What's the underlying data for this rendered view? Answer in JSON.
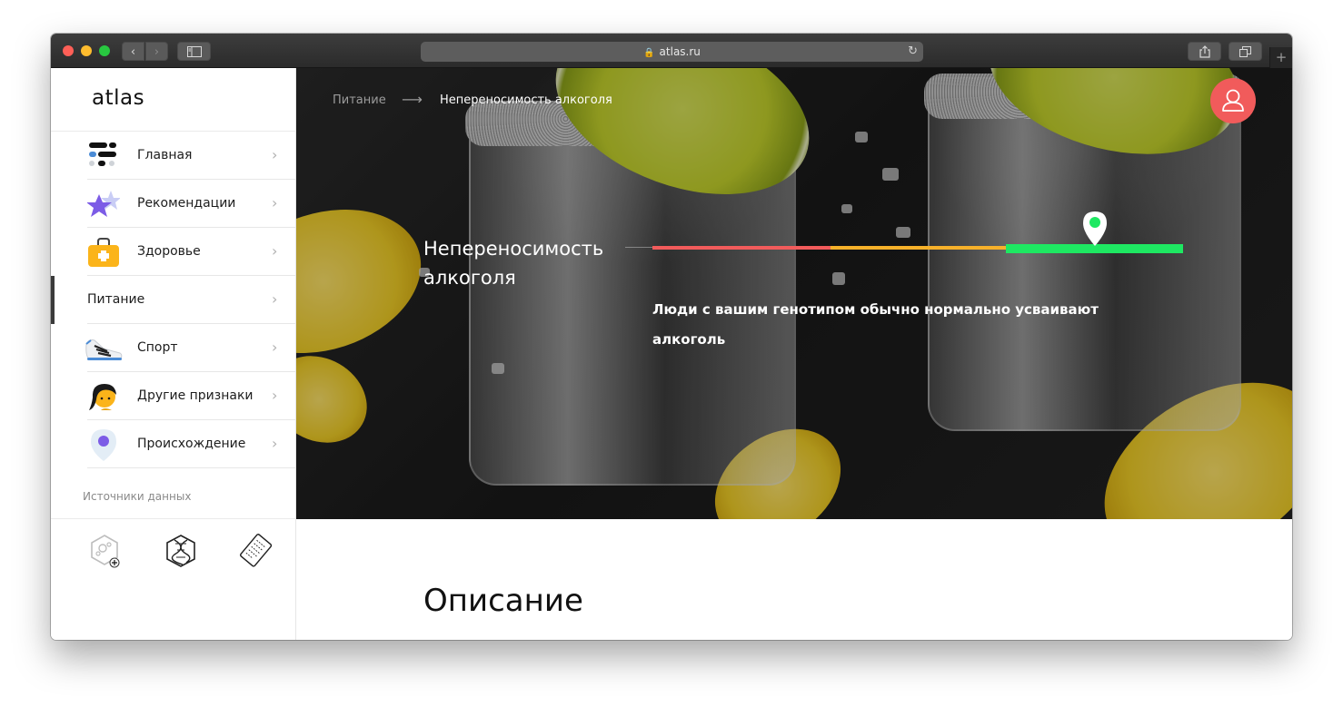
{
  "browser": {
    "url": "atlas.ru",
    "nav_back": "‹",
    "nav_forward": "›",
    "reload": "↻",
    "new_tab": "+"
  },
  "sidebar": {
    "logo": "atlas",
    "items": [
      {
        "label": "Главная",
        "icon": "home-grid-icon"
      },
      {
        "label": "Рекомендации",
        "icon": "stars-icon"
      },
      {
        "label": "Здоровье",
        "icon": "first-aid-kit-icon"
      },
      {
        "label": "Питание",
        "icon": ""
      },
      {
        "label": "Спорт",
        "icon": "sneaker-icon"
      },
      {
        "label": "Другие признаки",
        "icon": "person-face-icon"
      },
      {
        "label": "Происхождение",
        "icon": "location-pin-icon"
      }
    ],
    "active_index": 3,
    "chevron": "›",
    "sources_label": "Источники данных",
    "sources": [
      "microbiome-kit-icon",
      "dna-box-icon",
      "report-sheet-icon"
    ]
  },
  "main": {
    "breadcrumb": {
      "parent": "Питание",
      "arrow": "⟶",
      "current": "Непереносимость алкоголя"
    },
    "trait": {
      "title": "Непереносимость алкоголя",
      "result_text": "Люди с вашим генотипом обычно нормально усваивают алкоголь",
      "scale_level": 0.83
    },
    "section_title": "Описание"
  },
  "colors": {
    "accent_red": "#f15b5b",
    "scale_red": "#f25b5b",
    "scale_yellow": "#f7b12a",
    "scale_green": "#1ee862"
  }
}
